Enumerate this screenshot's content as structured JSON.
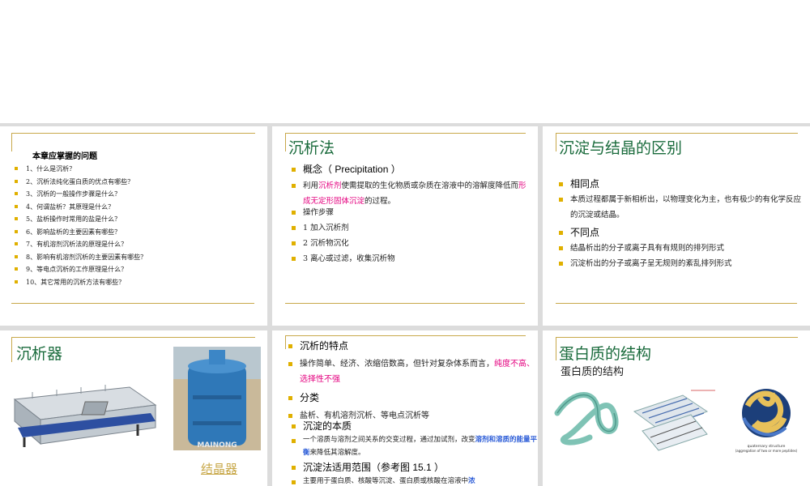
{
  "slides": {
    "s1": {
      "heading": "本章应掌握的问题",
      "questions": [
        "1、什么是沉析？",
        "2、沉析法纯化蛋白质的优点有哪些？",
        "3、沉析的一般操作步骤是什么？",
        "4、何谓盐析？其原理是什么？",
        "5、盐析操作时常用的盐是什么？",
        "6、影响盐析的主要因素有哪些？",
        "7、有机溶剂沉析法的原理是什么？",
        "8、影响有机溶剂沉析的主要因素有哪些？",
        "9、等电点沉析的工作原理是什么？",
        "10、其它常用的沉析方法有哪些？"
      ]
    },
    "s2": {
      "title": "沉析法",
      "concept": "概念（ Precipitation ）",
      "def_a": "利用",
      "def_b": "沉析剂",
      "def_c": "使需提取的生化物质或杂质在溶液中的溶解度降低而",
      "def_d": "形成无定形固体沉淀",
      "def_e": "的过程。",
      "steps_label": "操作步骤",
      "steps": [
        "1  加入沉析剂",
        "2  沉析物沉化",
        "3  离心或过滤，收集沉析物"
      ]
    },
    "s3": {
      "title": "沉淀与结晶的区别",
      "same_label": "相同点",
      "same_text": "本质过程都属于新相析出，以物理变化为主，也有极少的有化学反应的沉淀或结晶。",
      "diff_label": "不同点",
      "diff": [
        "结晶析出的分子或离子具有有规则的排列形式",
        "沉淀析出的分子或离子呈无规则的紊乱排列形式"
      ]
    },
    "s4": {
      "title": "沉析器",
      "caption": "结晶器",
      "watermark": "MAINONG"
    },
    "s5": {
      "features_label": "沉析的特点",
      "features_a": "操作简单、经济、浓缩倍数高，但针对复杂体系而言，",
      "features_b": "纯度不高、选择性不强",
      "class_label": "分类",
      "class_text": "盐析、有机溶剂沉析、等电点沉析等",
      "nature_label": "沉淀的本质",
      "nature_a": "一个溶质与溶剂之间关系的交变过程，通过加试剂，改变",
      "nature_b": "溶剂和溶质的能量平衡",
      "nature_c": "来降低其溶解度。",
      "scope_label": "沉淀法适用范围（参考图 15.1 ）",
      "scope_a": "主要用于蛋白质、核酸等沉淀、蛋白质或核酸在溶液中",
      "scope_b": "浓"
    },
    "s6": {
      "title": "蛋白质的结构",
      "subtitle": "蛋白质的结构",
      "fig_label": "quaternary structure",
      "fig_label2": "(aggregation of two or more peptides)"
    }
  },
  "colors": {
    "title_green": "#1a6b3c",
    "accent_gold": "#c8a84a",
    "bullet": "#e0b000",
    "highlight_pink": "#e4007f",
    "highlight_blue": "#2a5bd7"
  }
}
